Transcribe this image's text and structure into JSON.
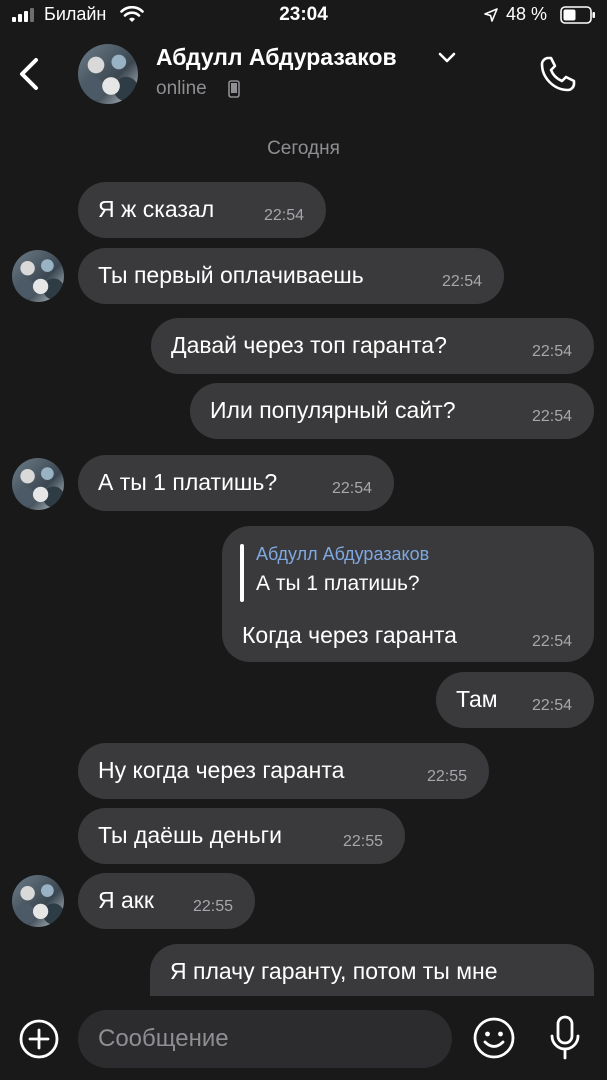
{
  "status_bar": {
    "carrier": "Билайн",
    "time": "23:04",
    "battery": "48 %"
  },
  "header": {
    "contact_name": "Абдулл Абдуразаков",
    "status": "online"
  },
  "chat": {
    "date_separator": "Сегодня",
    "messages": [
      {
        "text": "Я ж сказал",
        "time": "22:54"
      },
      {
        "text": "Ты первый оплачиваешь",
        "time": "22:54"
      },
      {
        "text": "Давай через топ гаранта?",
        "time": "22:54"
      },
      {
        "text": "Или популярный сайт?",
        "time": "22:54"
      },
      {
        "text": "А ты 1 платишь?",
        "time": "22:54"
      },
      {
        "reply_to_name": "Абдулл Абдуразаков",
        "reply_to_text": "А ты 1 платишь?",
        "text": "Когда через гаранта",
        "time": "22:54"
      },
      {
        "text": "Там",
        "time": "22:54"
      },
      {
        "text": "Ну когда через гаранта",
        "time": "22:55"
      },
      {
        "text": "Ты даёшь деньги",
        "time": "22:55"
      },
      {
        "text": "Я акк",
        "time": "22:55"
      },
      {
        "text": "Я плачу гаранту, потом ты мне",
        "time": ""
      }
    ]
  },
  "composer": {
    "placeholder": "Сообщение"
  },
  "icons": {
    "back": "chevron-left-icon",
    "call": "phone-icon",
    "attach": "plus-circle-icon",
    "sticker": "smiley-icon",
    "voice": "microphone-icon"
  },
  "colors": {
    "background": "#191919",
    "bubble": "#3a3a3c",
    "reply_name": "#7fa8e0",
    "muted": "#8e8e93"
  }
}
